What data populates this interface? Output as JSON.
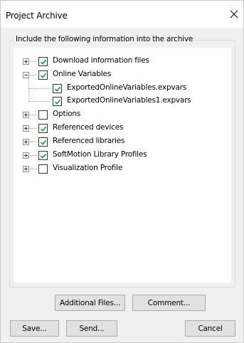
{
  "window": {
    "title": "Project Archive"
  },
  "group": {
    "legend": "Include the following information into the archive"
  },
  "tree": {
    "items": [
      {
        "label": "Download information files",
        "checked": true,
        "expander": "plus"
      },
      {
        "label": "Online Variables",
        "checked": true,
        "expander": "minus"
      },
      {
        "label": "ExportedOnlineVariables.expvars",
        "checked": true,
        "expander": "none"
      },
      {
        "label": "ExportedOnlineVariables1.expvars",
        "checked": true,
        "expander": "none"
      },
      {
        "label": "Options",
        "checked": false,
        "expander": "plus"
      },
      {
        "label": "Referenced devices",
        "checked": true,
        "expander": "plus"
      },
      {
        "label": "Referenced libraries",
        "checked": true,
        "expander": "plus"
      },
      {
        "label": "SoftMotion Library Profiles",
        "checked": true,
        "expander": "plus"
      },
      {
        "label": "Visualization Profile",
        "checked": false,
        "expander": "plus"
      }
    ]
  },
  "buttons": {
    "additional_files": "Additional Files...",
    "comment": "Comment...",
    "save": "Save...",
    "send": "Send...",
    "cancel": "Cancel"
  },
  "colors": {
    "check": "#1e8f3a",
    "dialog_bg": "#f0f0f0",
    "button_bg": "#e1e1e1"
  },
  "icons": {
    "close": "close-icon",
    "check": "checkmark-icon",
    "expand": "plus-expander-icon",
    "collapse": "minus-expander-icon"
  }
}
